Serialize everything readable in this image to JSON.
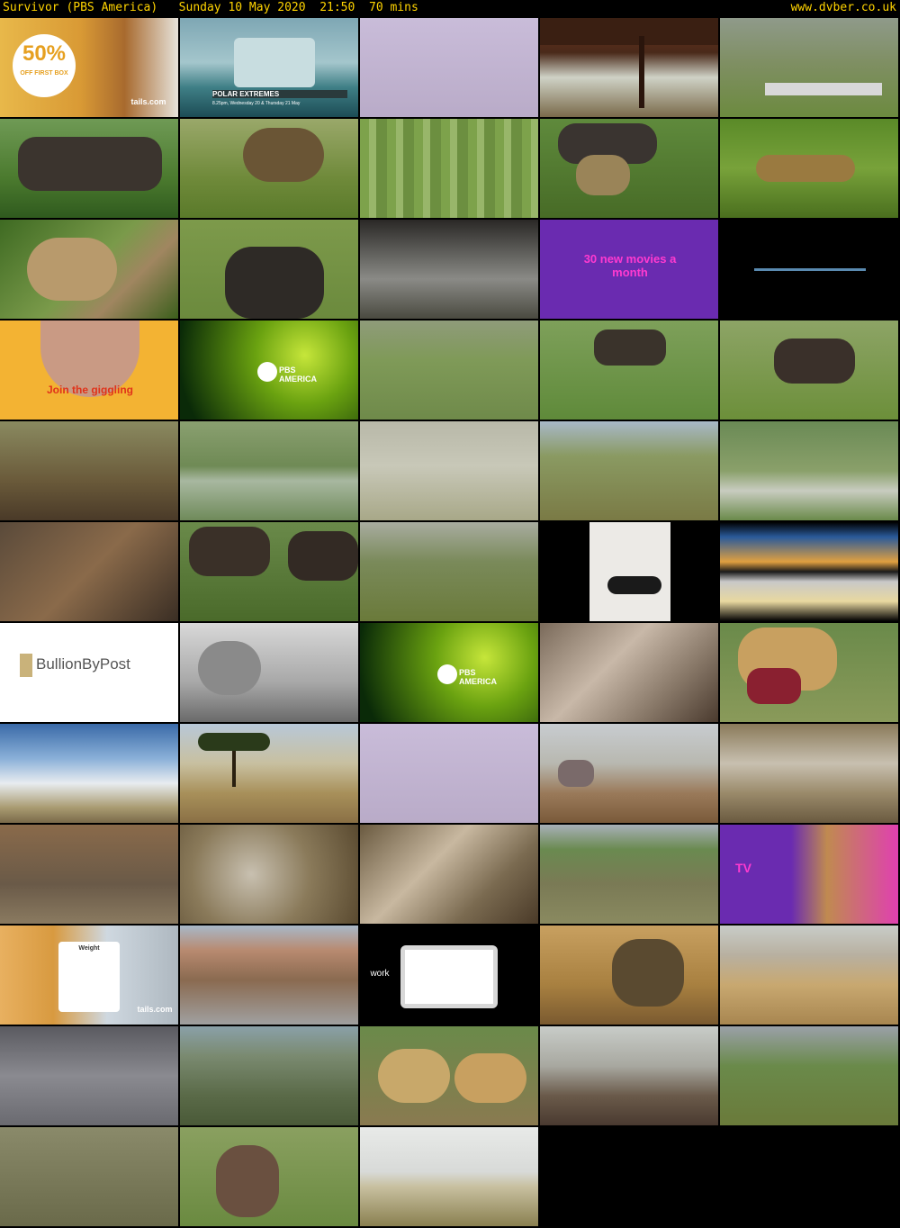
{
  "header": {
    "left_text": "Survivor (PBS America)   Sunday 10 May 2020  21:50  70 mins",
    "site": "www.dvber.co.uk"
  },
  "thumbnails": [
    {
      "scene": "tails-ad-50off",
      "text": "50%",
      "text2": "OFF FIRST BOX",
      "brand": "tails.com"
    },
    {
      "scene": "polar-extremes-promo",
      "text": "POLAR EXTREMES",
      "text2": "8.25pm, Wednesday 20 & Thursday 21 May"
    },
    {
      "scene": "lavender-blank"
    },
    {
      "scene": "tree-branches"
    },
    {
      "scene": "zebra-plains"
    },
    {
      "scene": "wildebeest-calf"
    },
    {
      "scene": "hyena-grass"
    },
    {
      "scene": "green-bars"
    },
    {
      "scene": "hyena-wildebeest"
    },
    {
      "scene": "lioness-run"
    },
    {
      "scene": "lioness-attack"
    },
    {
      "scene": "wildebeest-closeup"
    },
    {
      "scene": "storm-clouds"
    },
    {
      "scene": "now-tv-movies",
      "text": "30 new movies a month"
    },
    {
      "scene": "black-line"
    },
    {
      "scene": "join-the-giggling",
      "text": "Join the giggling"
    },
    {
      "scene": "pbs-america-ident",
      "text": "PBS AMERICA"
    },
    {
      "scene": "calves-plain"
    },
    {
      "scene": "calf-grass"
    },
    {
      "scene": "wildebeest-mother-calf"
    },
    {
      "scene": "calf-dirt"
    },
    {
      "scene": "lake-reflection"
    },
    {
      "scene": "calf-alone"
    },
    {
      "scene": "acacia-herd"
    },
    {
      "scene": "herd-river"
    },
    {
      "scene": "mud-closeup"
    },
    {
      "scene": "wildebeest-fight"
    },
    {
      "scene": "zebra-wildebeest-run"
    },
    {
      "scene": "yoga-woman"
    },
    {
      "scene": "sea-coral-ad"
    },
    {
      "scene": "bullion-by-post",
      "text": "BullionByPost"
    },
    {
      "scene": "cat-blanket"
    },
    {
      "scene": "pbs-america-ident",
      "text": "PBS AMERICA"
    },
    {
      "scene": "bones-closeup"
    },
    {
      "scene": "leopard-kill"
    },
    {
      "scene": "sky-plains"
    },
    {
      "scene": "acacia-savanna"
    },
    {
      "scene": "lavender-blank"
    },
    {
      "scene": "rocks-plain"
    },
    {
      "scene": "river-stork"
    },
    {
      "scene": "herd-drinking"
    },
    {
      "scene": "dust-cloud"
    },
    {
      "scene": "water-splash"
    },
    {
      "scene": "herd-distance"
    },
    {
      "scene": "now-tv-lion",
      "text": "TV"
    },
    {
      "scene": "tails-weight",
      "text": "Weight",
      "brand": "tails.com"
    },
    {
      "scene": "runners-street"
    },
    {
      "scene": "work-tablet",
      "text": "work"
    },
    {
      "scene": "baboons"
    },
    {
      "scene": "dry-plains"
    },
    {
      "scene": "herd-mud"
    },
    {
      "scene": "zebra-herd"
    },
    {
      "scene": "cheetahs"
    },
    {
      "scene": "leopard-tree"
    },
    {
      "scene": "herd-run"
    },
    {
      "scene": "herd-aerial"
    },
    {
      "scene": "wildebeest-newborn"
    },
    {
      "scene": "credits-plains"
    }
  ]
}
